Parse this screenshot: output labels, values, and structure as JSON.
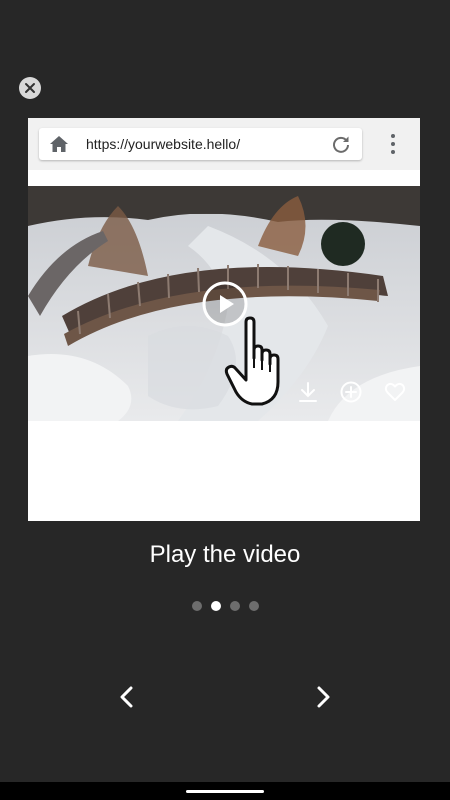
{
  "overlay": {
    "close_icon": "close-icon"
  },
  "browser": {
    "url": "https://yourwebsite.hello/",
    "home_icon": "home-icon",
    "reload_icon": "reload-icon",
    "menu_icon": "more-vert-icon"
  },
  "video": {
    "play_icon": "play-circle-icon",
    "gesture_icon": "hand-pointer-icon",
    "actions": [
      "download-icon",
      "add-circle-icon",
      "heart-icon"
    ]
  },
  "tutorial": {
    "caption": "Play the video",
    "page_count": 4,
    "active_page": 2
  },
  "navigation": {
    "prev_icon": "chevron-left-icon",
    "next_icon": "chevron-right-icon"
  },
  "colors": {
    "background": "#272727",
    "card": "#ffffff",
    "dot_active": "#ffffff",
    "dot_inactive": "#6d6d6d"
  }
}
